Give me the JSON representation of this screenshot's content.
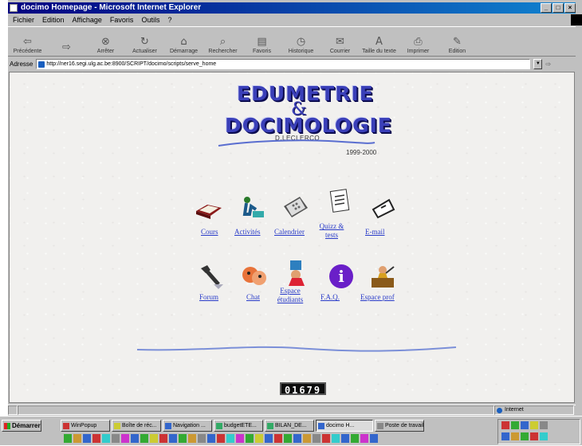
{
  "window": {
    "title": "docimo Homepage - Microsoft Internet Explorer",
    "controls": [
      "_",
      "□",
      "×"
    ]
  },
  "menu": [
    "Fichier",
    "Edition",
    "Affichage",
    "Favoris",
    "Outils",
    "?"
  ],
  "toolbar": [
    {
      "label": "Précédente",
      "icon": "back-arrow-icon",
      "glyph": "⇦"
    },
    {
      "label": "",
      "icon": "forward-arrow-icon",
      "glyph": "⇨"
    },
    {
      "label": "Arrêter",
      "icon": "stop-icon",
      "glyph": "⊗"
    },
    {
      "label": "Actualiser",
      "icon": "refresh-icon",
      "glyph": "↻"
    },
    {
      "label": "Démarrage",
      "icon": "home-icon",
      "glyph": "⌂"
    },
    {
      "label": "Rechercher",
      "icon": "search-icon",
      "glyph": "⌕"
    },
    {
      "label": "Favoris",
      "icon": "favorites-icon",
      "glyph": "▤"
    },
    {
      "label": "Historique",
      "icon": "history-icon",
      "glyph": "◷"
    },
    {
      "label": "Courrier",
      "icon": "mail-icon",
      "glyph": "✉"
    },
    {
      "label": "Taille du texte",
      "icon": "font-size-icon",
      "glyph": "A"
    },
    {
      "label": "Imprimer",
      "icon": "print-icon",
      "glyph": "⎙"
    },
    {
      "label": "Edition",
      "icon": "edit-icon",
      "glyph": "✎"
    }
  ],
  "address": {
    "label": "Adresse",
    "url": "http://ner16.segi.ulg.ac.be:8900/SCRIPT/docimo/scripts/serve_home",
    "go": "⇨"
  },
  "page": {
    "logo_line1": "EDUMETRIE",
    "logo_amp": "&",
    "logo_line2": "DOCIMOLOGIE",
    "author": "D.LECLERCQ",
    "years": "1999-2000",
    "links": [
      {
        "label": "Cours",
        "icon": "book-icon"
      },
      {
        "label": "Activités",
        "icon": "activity-icon"
      },
      {
        "label": "Calendrier",
        "icon": "calendar-icon"
      },
      {
        "label": "Quizz & tests",
        "icon": "quiz-icon"
      },
      {
        "label": "E-mail",
        "icon": "email-icon"
      },
      {
        "label": "Forum",
        "icon": "forum-icon"
      },
      {
        "label": "Chat",
        "icon": "chat-icon"
      },
      {
        "label": "Espace étudiants",
        "icon": "students-icon"
      },
      {
        "label": "F.A.Q.",
        "icon": "faq-icon"
      },
      {
        "label": "Espace prof",
        "icon": "teacher-icon"
      }
    ],
    "counter": "01679"
  },
  "statusbar": {
    "zone": "Internet"
  },
  "taskbar": {
    "start": "Démarrer",
    "tasks": [
      "WinPopup",
      "Boîte de réc...",
      "Navigation ...",
      "budgetETE...",
      "BILAN_DE...",
      "docimo H...",
      "Poste de travail"
    ],
    "active_index": 5
  },
  "colors": {
    "logo": "#3a3fb8",
    "link": "#2a3cc9",
    "title_start": "#000080",
    "title_end": "#1084d0",
    "page_bg": "#f1f0ee"
  }
}
